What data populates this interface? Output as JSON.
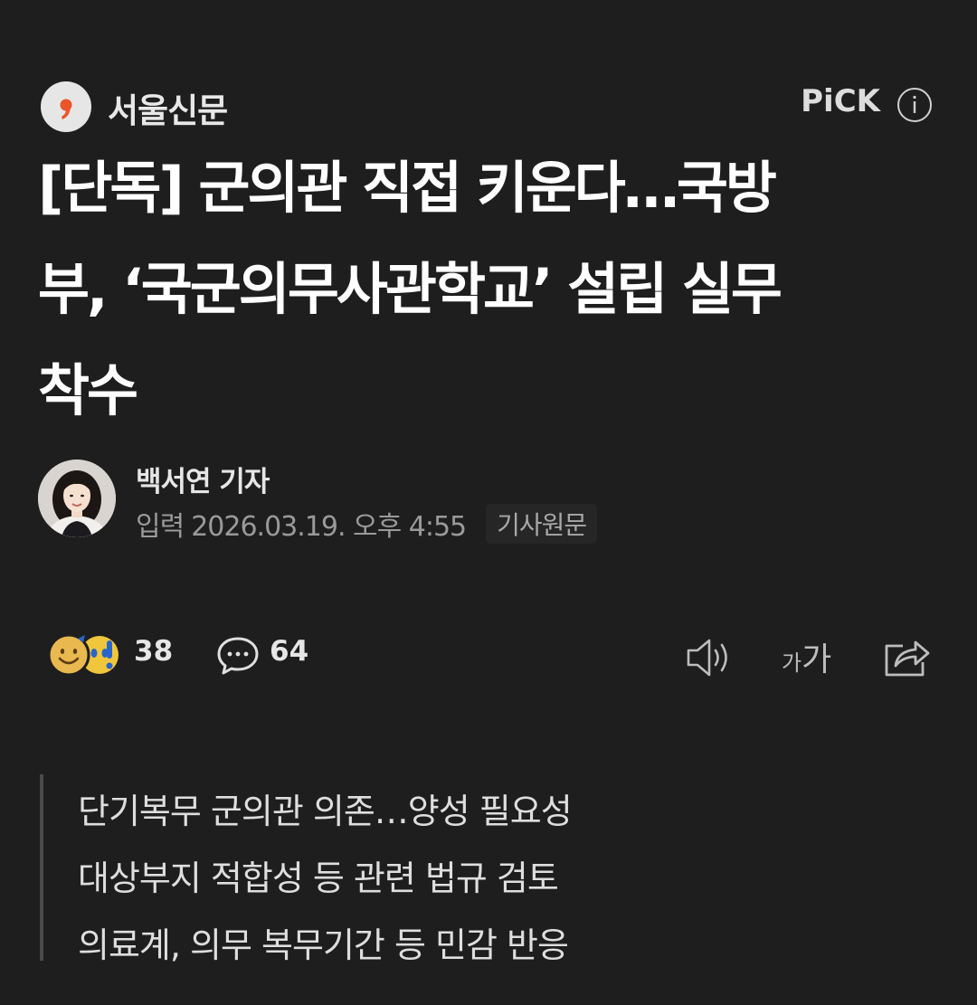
{
  "press": {
    "name": "서울신문",
    "pick_label": "PiCK",
    "logo_icon": "comma-logo-icon",
    "info_icon": "info-icon"
  },
  "headline": "[단독] 군의관 직접 키운다…국방\n부, ‘국군의무사관학교’ 설립 실무\n착수",
  "reporter": {
    "name": "백서연 기자",
    "date_prefix": "입력",
    "date": "2026.03.19. 오후 4:55",
    "original_link": "기사원문"
  },
  "actions": {
    "reaction_count": "38",
    "comment_count": "64",
    "font_small": "가",
    "font_large": "가",
    "icons": [
      "reaction-emoji-icon",
      "comment-icon",
      "speaker-icon",
      "font-size-icon",
      "share-icon"
    ]
  },
  "summary": {
    "lines": [
      "단기복무 군의관 의존…양성 필요성",
      "대상부지 적합성 등 관련 법규 검토",
      "의료계, 의무 복무기간 등 민감 반응"
    ]
  },
  "colors": {
    "background": "#1e1e1e",
    "text": "#ffffff",
    "muted": "#9a9a9a",
    "logo_accent": "#e8562a"
  }
}
